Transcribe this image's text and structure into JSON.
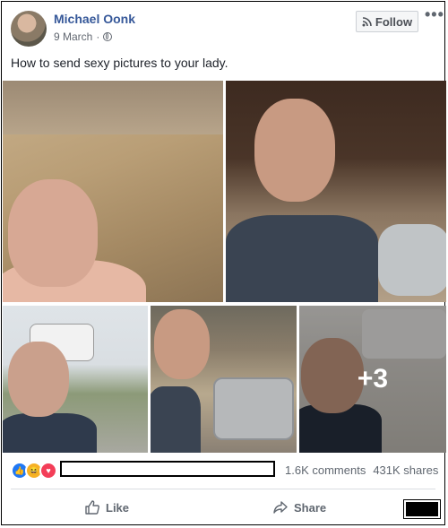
{
  "post": {
    "author": "Michael Oonk",
    "date": "9 March",
    "follow_label": "Follow",
    "more_label": "•••",
    "caption": "How to send sexy pictures to your lady.",
    "more_photos": "+3"
  },
  "stats": {
    "comments": "1.6K comments",
    "shares": "431K shares"
  },
  "actions": {
    "like": "Like",
    "share": "Share"
  },
  "icons": [
    "globe-icon",
    "rss-icon",
    "like-reaction-icon",
    "haha-reaction-icon",
    "love-reaction-icon",
    "thumbs-up-icon",
    "share-arrow-icon"
  ],
  "colors": {
    "name": "#365899",
    "like_reaction": "#2078f4",
    "haha_reaction": "#f7b125",
    "love_reaction": "#f33e58"
  }
}
